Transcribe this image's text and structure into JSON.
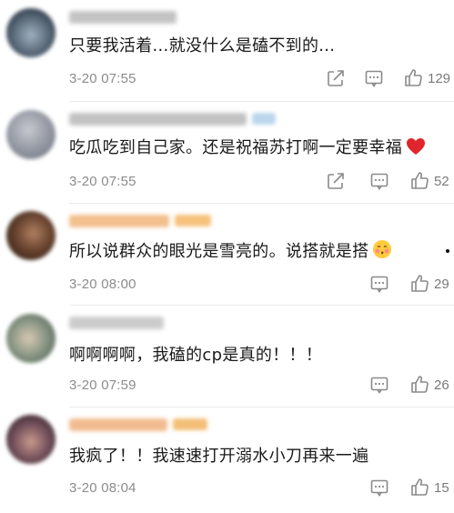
{
  "comments": [
    {
      "text": "只要我活着...就没什么是磕不到的...",
      "time": "3-20 07:55",
      "likes": "129",
      "avatar_colors": [
        "#2d3a48",
        "#9fb0bf"
      ],
      "username_color": "#b9b9b9",
      "badge": false
    },
    {
      "text": "吃瓜吃到自己家。还是祝福苏打啊一定要幸福",
      "emoji": "red-heart-emoji",
      "time": "3-20 07:55",
      "likes": "52",
      "avatar_colors": [
        "#7a7f8c",
        "#c7c9cf"
      ],
      "username_color": "#b8b8b8",
      "badge": true,
      "badge_color": "#bcd6ee"
    },
    {
      "text": "所以说群众的眼光是雪亮的。说搭就是搭",
      "emoji": "kissing-face-emoji",
      "time": "3-20 08:00",
      "likes": "29",
      "avatar_colors": [
        "#3a2518",
        "#b08060"
      ],
      "username_color": "#f0b47a",
      "badge": true,
      "badge_color": "#f6c27c"
    },
    {
      "text": "啊啊啊啊，我磕的cp是真的！！！",
      "time": "3-20 07:59",
      "likes": "26",
      "avatar_colors": [
        "#5d6e60",
        "#d7c8b4"
      ],
      "username_color": "#c3c3c3",
      "badge": false
    },
    {
      "text": "我疯了！！我速速打开溺水小刀再来一遍",
      "time": "3-20 08:04",
      "likes": "15",
      "avatar_colors": [
        "#3d2a33",
        "#c89a8a"
      ],
      "username_color": "#efb07c",
      "badge": true,
      "badge_color": "#f3bf78"
    }
  ],
  "icons": {
    "share": "share-icon",
    "comment": "comment-icon",
    "like": "thumbs-up-icon"
  }
}
